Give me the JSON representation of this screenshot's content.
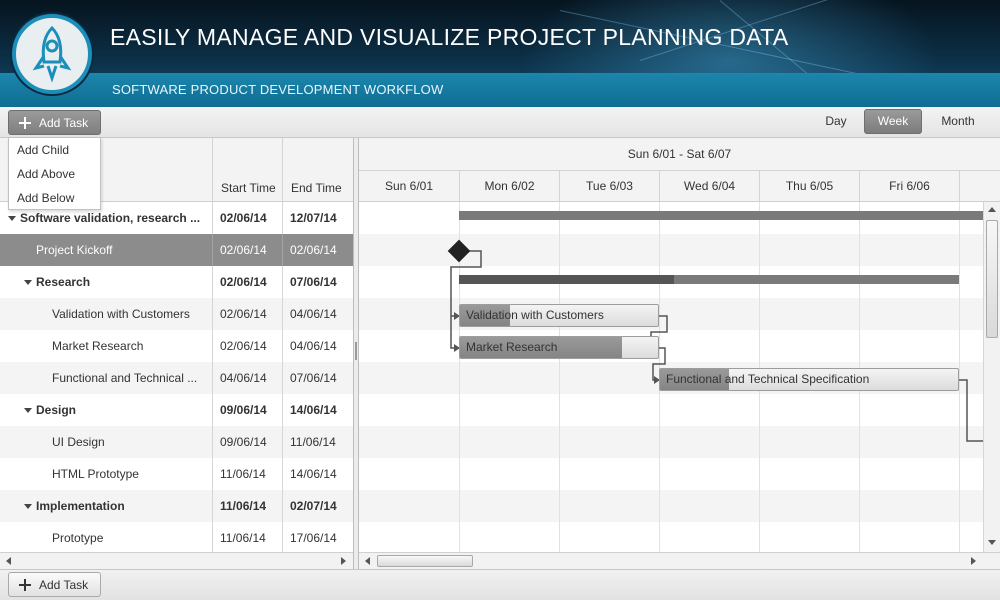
{
  "header": {
    "title": "EASILY MANAGE AND VISUALIZE PROJECT PLANNING DATA",
    "subtitle": "SOFTWARE PRODUCT DEVELOPMENT WORKFLOW",
    "logo_icon": "rocket-icon"
  },
  "toolbar": {
    "add_task_label": "Add Task",
    "views": [
      "Day",
      "Week",
      "Month"
    ],
    "active_view": "Week"
  },
  "add_menu": {
    "items": [
      "Add Child",
      "Add Above",
      "Add Below"
    ]
  },
  "grid": {
    "columns": [
      "Start Time",
      "End Time"
    ],
    "rows": [
      {
        "name": "Software validation, research ...",
        "start": "02/06/14",
        "end": "12/07/14",
        "level": 0,
        "summary": true,
        "selected": false
      },
      {
        "name": "Project Kickoff",
        "start": "02/06/14",
        "end": "02/06/14",
        "level": 1,
        "summary": false,
        "selected": true
      },
      {
        "name": "Research",
        "start": "02/06/14",
        "end": "07/06/14",
        "level": 1,
        "summary": true,
        "selected": false
      },
      {
        "name": "Validation with Customers",
        "start": "02/06/14",
        "end": "04/06/14",
        "level": 2,
        "summary": false,
        "selected": false
      },
      {
        "name": "Market Research",
        "start": "02/06/14",
        "end": "04/06/14",
        "level": 2,
        "summary": false,
        "selected": false
      },
      {
        "name": "Functional and Technical ...",
        "start": "04/06/14",
        "end": "07/06/14",
        "level": 2,
        "summary": false,
        "selected": false
      },
      {
        "name": "Design",
        "start": "09/06/14",
        "end": "14/06/14",
        "level": 1,
        "summary": true,
        "selected": false
      },
      {
        "name": "UI Design",
        "start": "09/06/14",
        "end": "11/06/14",
        "level": 2,
        "summary": false,
        "selected": false
      },
      {
        "name": "HTML Prototype",
        "start": "11/06/14",
        "end": "14/06/14",
        "level": 2,
        "summary": false,
        "selected": false
      },
      {
        "name": "Implementation",
        "start": "11/06/14",
        "end": "02/07/14",
        "level": 1,
        "summary": true,
        "selected": false
      },
      {
        "name": "Prototype",
        "start": "11/06/14",
        "end": "17/06/14",
        "level": 2,
        "summary": false,
        "selected": false
      }
    ]
  },
  "gantt": {
    "week_label": "Sun 6/01 - Sat 6/07",
    "days": [
      "Sun 6/01",
      "Mon 6/02",
      "Tue 6/03",
      "Wed 6/04",
      "Thu 6/05",
      "Fri 6/06"
    ],
    "task_labels": {
      "validation": "Validation with Customers",
      "market": "Market Research",
      "functional": "Functional and Technical Specification"
    },
    "progress": {
      "research_summary": 0.43,
      "validation": 0.25,
      "market": 0.82,
      "functional": 0.23
    }
  },
  "footer": {
    "add_task_label": "Add Task"
  }
}
